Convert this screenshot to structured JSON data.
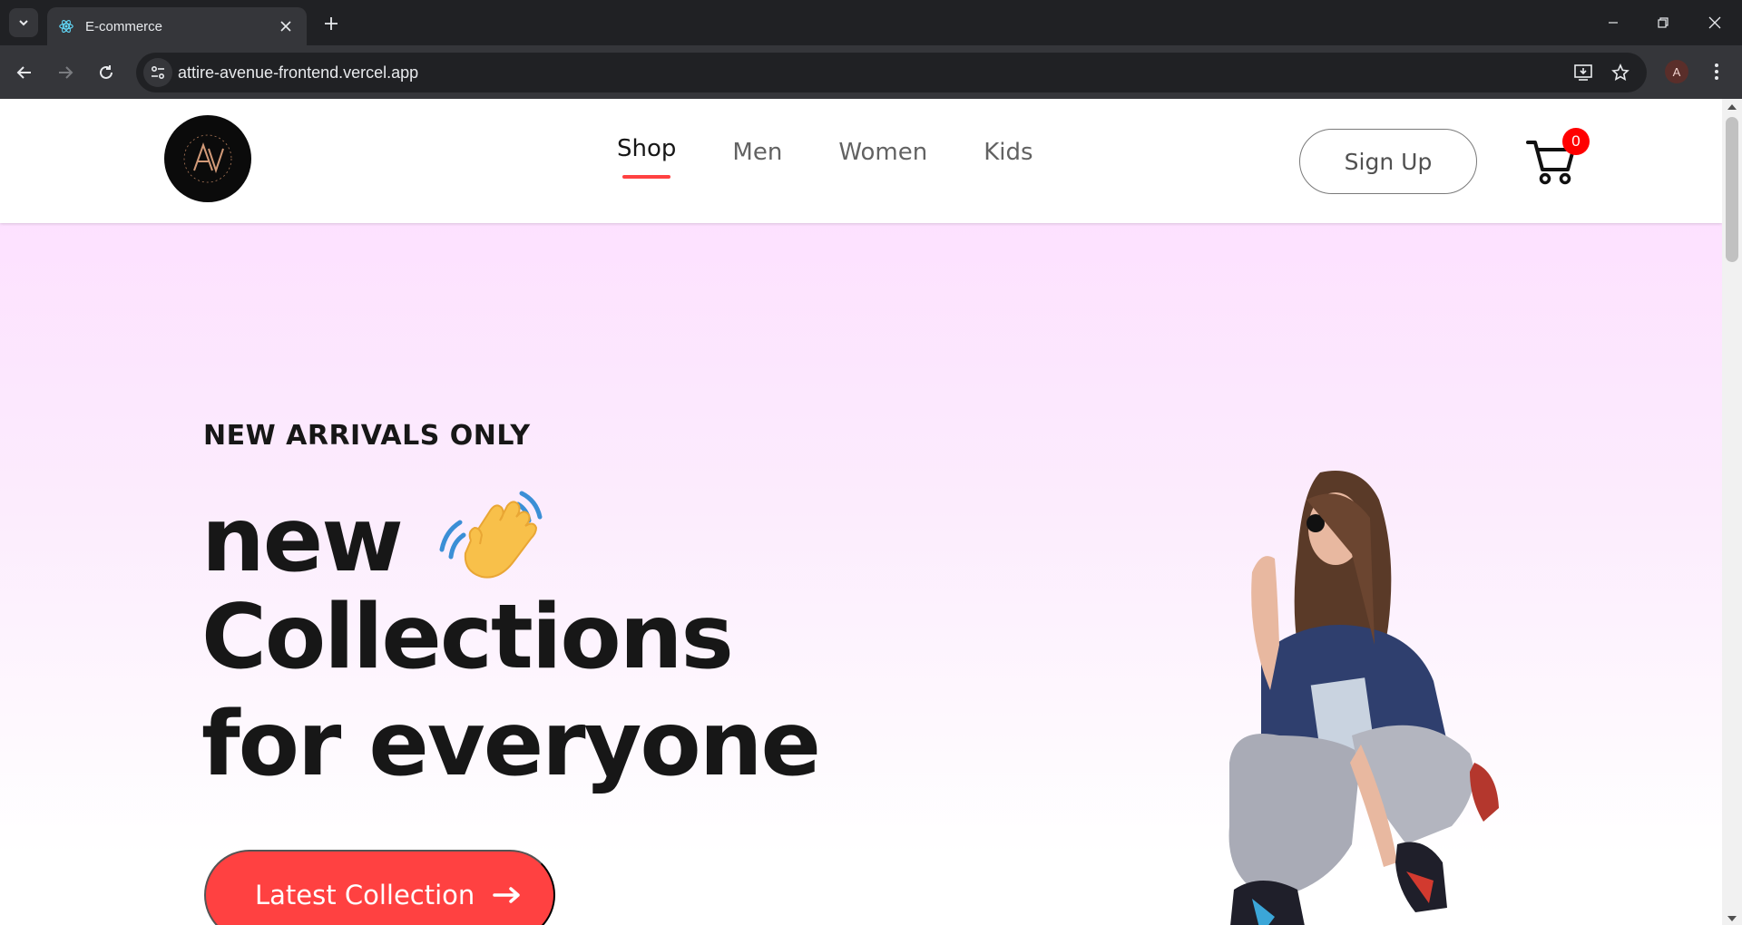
{
  "browser": {
    "tab_title": "E-commerce",
    "url": "attire-avenue-frontend.vercel.app",
    "profile_initial": "A"
  },
  "navbar": {
    "menu": [
      {
        "label": "Shop",
        "active": true
      },
      {
        "label": "Men",
        "active": false
      },
      {
        "label": "Women",
        "active": false
      },
      {
        "label": "Kids",
        "active": false
      }
    ],
    "signup_label": "Sign Up",
    "cart_count": "0"
  },
  "hero": {
    "tagline": "NEW ARRIVALS ONLY",
    "line1": "new",
    "line2": "Collections",
    "line3": "for everyone",
    "cta_label": "Latest Collection",
    "icons": [
      "waving-hand-icon",
      "arrow-right-icon"
    ]
  },
  "colors": {
    "accent": "#ff4141",
    "cart_badge": "#ff0000",
    "hero_gradient_top": "#fde1ff",
    "text_dark": "#171717"
  }
}
